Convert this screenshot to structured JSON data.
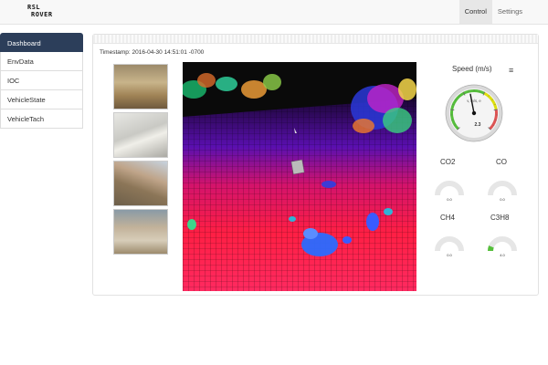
{
  "nav": {
    "logo_line1": "RSL",
    "logo_line2": "ROVER",
    "links": [
      {
        "label": "Control",
        "active": true
      },
      {
        "label": "Settings",
        "active": false
      }
    ]
  },
  "sidebar": {
    "items": [
      {
        "label": "Dashboard",
        "active": true
      },
      {
        "label": "EnvData",
        "active": false
      },
      {
        "label": "IOC",
        "active": false
      },
      {
        "label": "VehicleState",
        "active": false
      },
      {
        "label": "VehicleTach",
        "active": false
      }
    ]
  },
  "main": {
    "timestamp": "Timestamp: 2016-04-30 14:51:01 -0700",
    "thumbnails": [
      "site-photo-1",
      "site-photo-2",
      "site-photo-3",
      "site-photo-4"
    ]
  },
  "gauges": {
    "speed": {
      "title": "Speed (m/s)",
      "value": 2.3,
      "unit_label": "v, m/s, e",
      "max": 5,
      "value_text": "2.3"
    },
    "gases": [
      {
        "label": "CO2",
        "value": 0,
        "value_text": "0.0",
        "fraction": 0
      },
      {
        "label": "CO",
        "value": 0,
        "value_text": "0.0",
        "fraction": 0
      },
      {
        "label": "CH4",
        "value": 0,
        "value_text": "0.0",
        "fraction": 0
      },
      {
        "label": "C3H8",
        "value": 4.0,
        "value_text": "4.0",
        "fraction": 0.12
      }
    ],
    "colors": {
      "green": "#55bf3b",
      "yellow": "#dddf0d",
      "red": "#df5353",
      "face": "#e6e6e6"
    }
  },
  "icons": {
    "menu": "hamburger-menu-icon"
  }
}
